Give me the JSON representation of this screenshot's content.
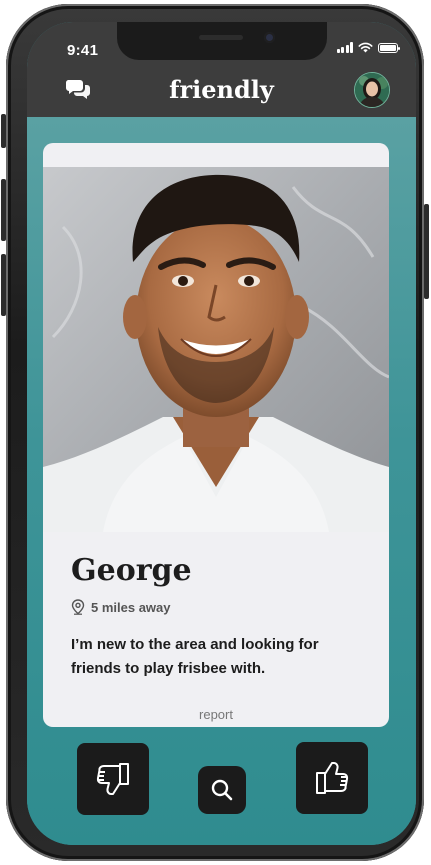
{
  "status_bar": {
    "time": "9:41"
  },
  "header": {
    "brand": "friendly",
    "chat_icon": "chat-bubbles-icon",
    "avatar": "user-avatar"
  },
  "profile": {
    "name": "George",
    "distance": "5 miles away",
    "bio": "I’m new to the area and looking for friends to play frisbee with.",
    "report_label": "report"
  },
  "actions": {
    "dislike_icon": "thumbs-down-icon",
    "search_icon": "search-icon",
    "like_icon": "thumbs-up-icon"
  },
  "colors": {
    "accent": "#3b9297",
    "header_bg": "#3d3d3d",
    "button_bg": "#1b1b1b",
    "card_bg": "#f0f0f3"
  }
}
